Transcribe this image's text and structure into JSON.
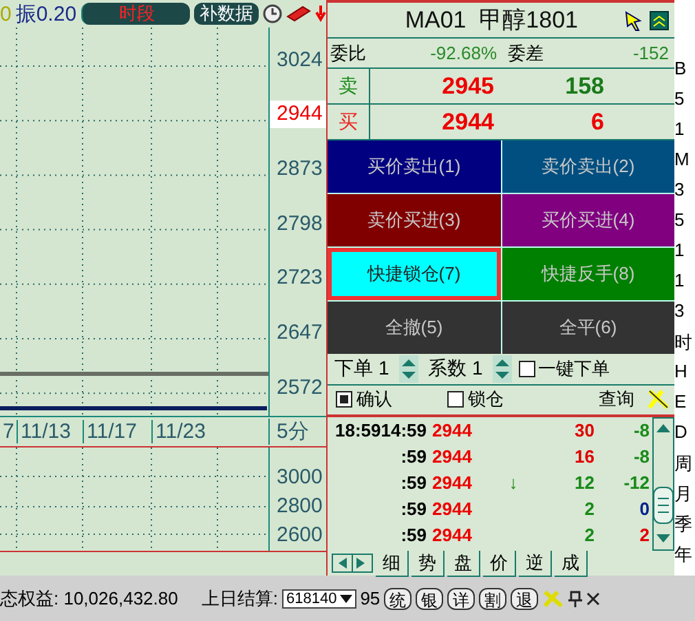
{
  "quote_bar": {
    "lead": "0",
    "amplitude": "振0.20",
    "buttons": [
      {
        "label": "时段",
        "kind": "period"
      },
      {
        "label": "补数据",
        "kind": "fill"
      }
    ]
  },
  "chart": {
    "price_axis": [
      {
        "label": "3024",
        "current": false
      },
      {
        "label": "2944",
        "current": true
      },
      {
        "label": "2873",
        "current": false
      },
      {
        "label": "2798",
        "current": false
      },
      {
        "label": "2723",
        "current": false
      },
      {
        "label": "2647",
        "current": false
      },
      {
        "label": "2572",
        "current": false
      }
    ],
    "dates": [
      "7",
      "11/13",
      "11/17",
      "11/23"
    ],
    "period": "5分",
    "sub_axis": [
      "3000",
      "2800",
      "2600"
    ]
  },
  "panel": {
    "title": "MA01  甲醇1801",
    "ratio_label": "委比",
    "ratio": "-92.68%",
    "diff_label": "委差",
    "diff": "-152",
    "quotes": [
      {
        "kind": "sell",
        "label": "卖",
        "price": "2945",
        "volume": "158"
      },
      {
        "kind": "buy",
        "label": "买",
        "price": "2944",
        "volume": "6"
      }
    ],
    "actions": [
      {
        "label": "买价卖出(1)",
        "color": "#000080",
        "selected": false
      },
      {
        "label": "卖价卖出(2)",
        "color": "#004f80",
        "selected": false
      },
      {
        "label": "卖价买进(3)",
        "color": "#800000",
        "selected": false
      },
      {
        "label": "买价买进(4)",
        "color": "#800080",
        "selected": false
      },
      {
        "label": "快捷锁仓(7)",
        "color": "#00ffff",
        "selected": true
      },
      {
        "label": "快捷反手(8)",
        "color": "#008000",
        "selected": false
      },
      {
        "label": "全撤(5)",
        "color": "#333333",
        "selected": false
      },
      {
        "label": "全平(6)",
        "color": "#333333",
        "selected": false
      }
    ],
    "order_qty": "下单 1",
    "factor": "系数 1",
    "one_click": {
      "label": "一键下单",
      "checked": false
    },
    "options": [
      {
        "label": "确认",
        "checked": true
      },
      {
        "label": "锁仓",
        "checked": false
      }
    ],
    "query": "查询",
    "trades": [
      {
        "time": "18:5914:59",
        "price": "2944",
        "volume": {
          "text": "30",
          "color": "#e00000"
        },
        "change": {
          "text": "-8",
          "color": "#1a8a1a"
        }
      },
      {
        "time": ":59",
        "price": "2944",
        "volume": {
          "text": "16",
          "color": "#e00000"
        },
        "change": {
          "text": "-8",
          "color": "#1a8a1a"
        }
      },
      {
        "time": ":59",
        "price": "2944",
        "arrow": "↓",
        "volume": {
          "text": "12",
          "color": "#1a8a1a"
        },
        "change": {
          "text": "-12",
          "color": "#1a8a1a"
        }
      },
      {
        "time": ":59",
        "price": "2944",
        "volume": {
          "text": "2",
          "color": "#1a8a1a"
        },
        "change": {
          "text": "0",
          "color": "#002288"
        }
      },
      {
        "time": ":59",
        "price": "2944",
        "volume": {
          "text": "2",
          "color": "#1a8a1a"
        },
        "change": {
          "text": "2",
          "color": "#e00000"
        }
      }
    ],
    "tabs": [
      "细",
      "势",
      "盘",
      "价",
      "逆",
      "成"
    ]
  },
  "period_strip": [
    "B",
    "5",
    "1",
    "M",
    "3",
    "5",
    "1",
    "1",
    "3",
    "时",
    "H",
    "E",
    "D",
    "周",
    "月",
    "季",
    "年"
  ],
  "status_bar": {
    "equity": "态权益: 10,026,432.80",
    "settle_label": "上日结算:",
    "settle_value": "618140",
    "partial": "95",
    "buttons": [
      "统",
      "银",
      "详",
      "割",
      "退"
    ]
  }
}
